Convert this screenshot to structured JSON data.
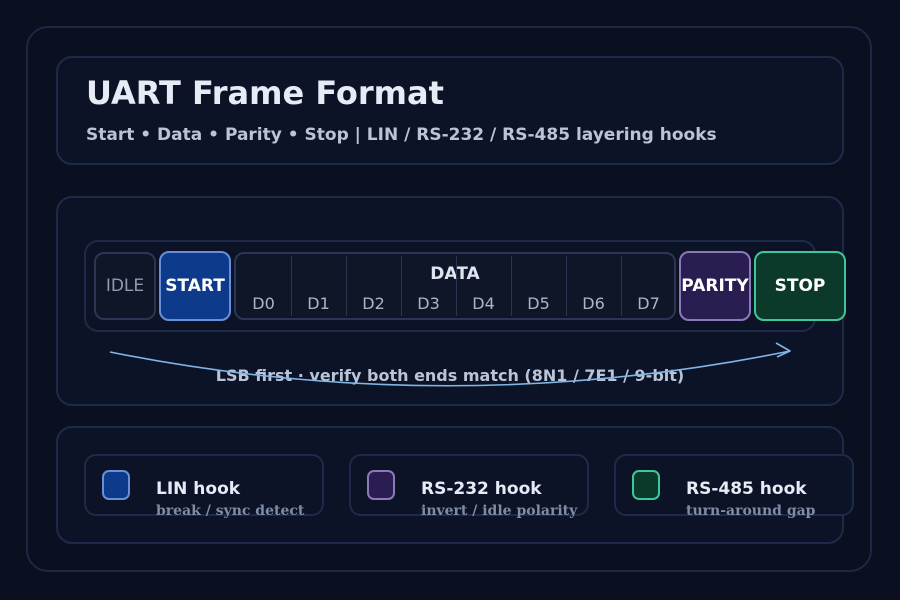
{
  "header": {
    "title": "UART Frame Format",
    "subtitle": "Start • Data • Parity • Stop | LIN / RS-232 / RS-485 layering hooks"
  },
  "frame": {
    "idle_label": "IDLE",
    "start_label": "START",
    "data_label": "DATA",
    "bits": [
      "D0",
      "D1",
      "D2",
      "D3",
      "D4",
      "D5",
      "D6",
      "D7"
    ],
    "parity_label": "PARITY",
    "stop_label": "STOP",
    "caption": "LSB first · verify both ends match (8N1 / 7E1 / 9-bit)"
  },
  "legend": [
    {
      "title": "LIN hook",
      "desc": "break / sync detect",
      "color": "#0e3a8c",
      "border": "#6a8fd8"
    },
    {
      "title": "RS-232 hook",
      "desc": "invert / idle polarity",
      "color": "#2a1d52",
      "border": "#8c7ab8"
    },
    {
      "title": "RS-485 hook",
      "desc": "turn-around gap",
      "color": "#0b3a2b",
      "border": "#3fc79a"
    }
  ],
  "colors": {
    "background": "#0b1020",
    "start": "#0e3a8c",
    "parity": "#2a1d52",
    "stop": "#0b3a2b",
    "arrow": "#7fb6e6"
  }
}
